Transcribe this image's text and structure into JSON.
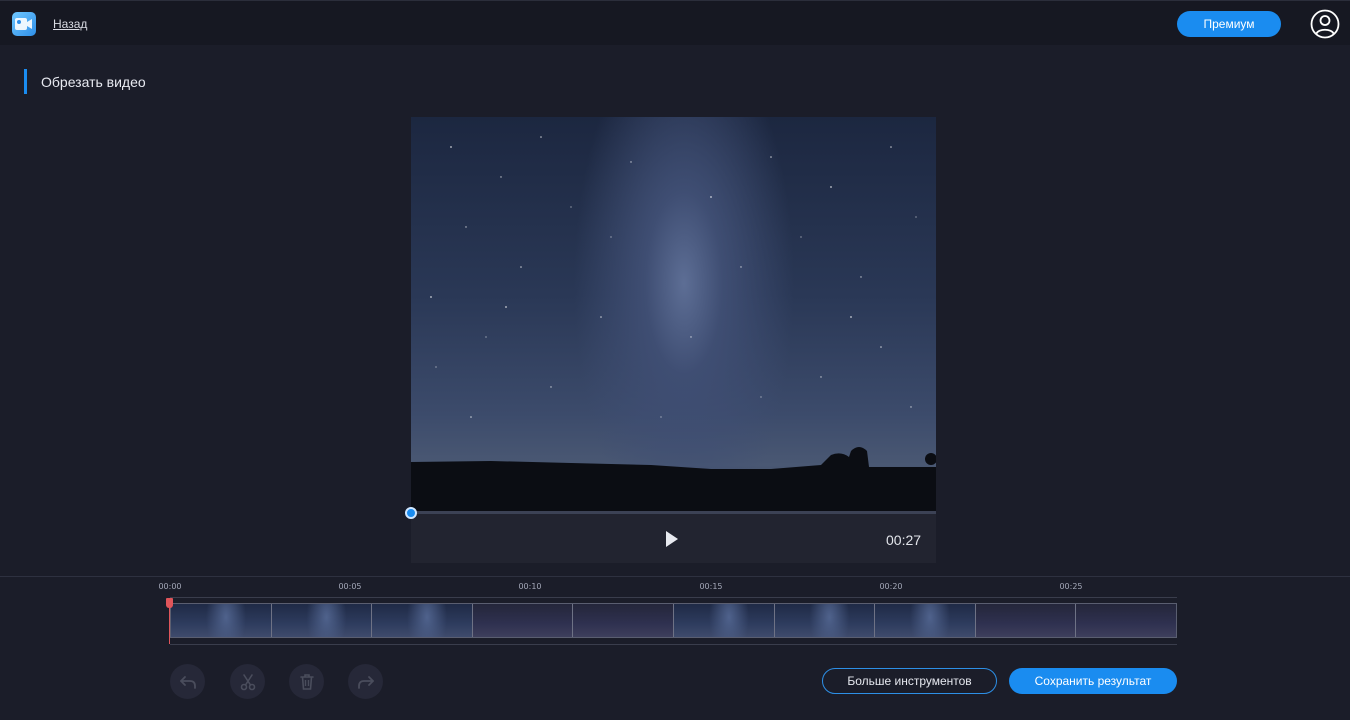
{
  "header": {
    "back_label": "Назад",
    "premium_label": "Премиум"
  },
  "page": {
    "title": "Обрезать видео"
  },
  "player": {
    "time": "00:27",
    "progress": 0
  },
  "timeline": {
    "ticks": [
      "00:00",
      "00:05",
      "00:10",
      "00:15",
      "00:20",
      "00:25"
    ]
  },
  "actions": {
    "more_tools_label": "Больше инструментов",
    "save_label": "Сохранить результат"
  },
  "colors": {
    "accent": "#1a8cf0",
    "playhead": "#e0555a",
    "background": "#1b1d29"
  },
  "icons": {
    "app": "video-editor-icon",
    "avatar": "user-icon",
    "play": "play-icon",
    "undo": "undo-icon",
    "cut": "scissors-icon",
    "delete": "trash-icon",
    "redo": "redo-icon"
  }
}
